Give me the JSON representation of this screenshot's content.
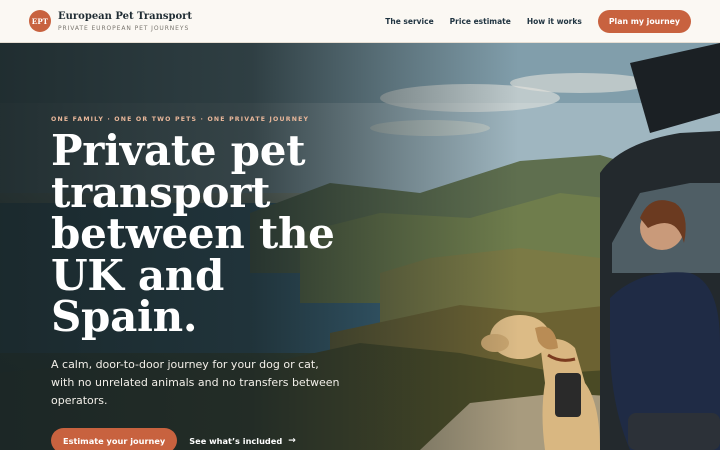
{
  "header": {
    "logo_initials": "EPT",
    "brand_name": "European Pet Transport",
    "brand_tagline": "PRIVATE EUROPEAN PET JOURNEYS",
    "nav": [
      {
        "label": "The service"
      },
      {
        "label": "Price estimate"
      },
      {
        "label": "How it works"
      }
    ],
    "cta_label": "Plan my journey"
  },
  "hero": {
    "eyebrow": "ONE FAMILY · ONE OR TWO PETS · ONE PRIVATE JOURNEY",
    "headline": "Private pet transport between the UK and Spain.",
    "subtext": "A calm, door-to-door journey for your dog or cat, with no unrelated animals and no transfers between operators.",
    "primary_cta": "Estimate your journey",
    "secondary_cta": "See what’s included",
    "secondary_cta_icon": "→"
  },
  "colors": {
    "accent": "#c8623f",
    "header_bg": "#fbf8f3",
    "navy_text": "#1f3340",
    "eyebrow": "#e9b79a"
  }
}
